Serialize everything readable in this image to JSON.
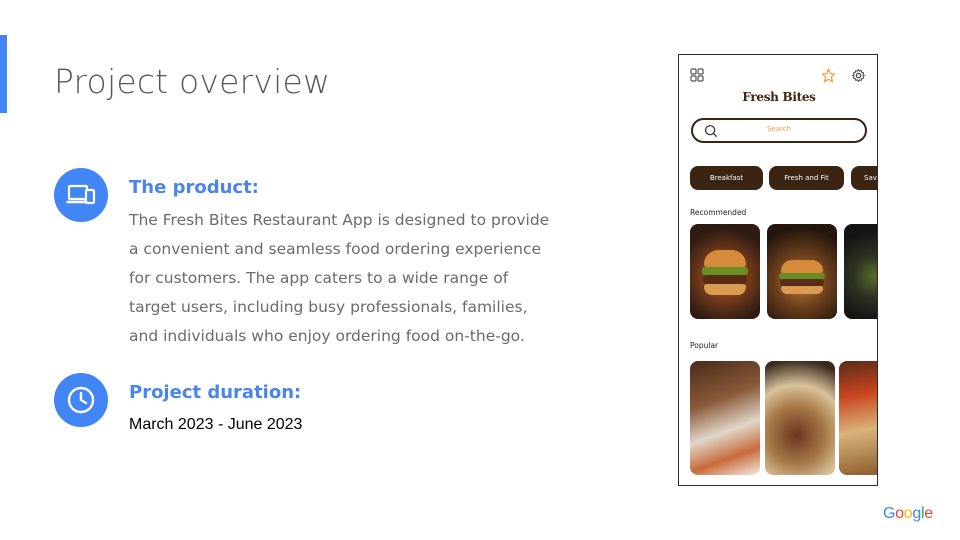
{
  "slide": {
    "title": "Project overview"
  },
  "product": {
    "heading": "The product:",
    "description": "The Fresh Bites Restaurant App is designed to provide a convenient and seamless food ordering experience for customers. The app caters to a wide range of target users, including busy professionals, families, and individuals who enjoy ordering food on-the-go.",
    "icon": "devices-icon"
  },
  "duration": {
    "heading": "Project duration:",
    "dates": "March 2023 - June 2023",
    "icon": "clock-icon"
  },
  "phone_mockup": {
    "brand": "Fresh Bites",
    "search_placeholder": "Search",
    "chips": [
      "Breakfast",
      "Fresh and Fit",
      "Sav"
    ],
    "recommended_label": "Recommended",
    "popular_label": "Popular",
    "icons": [
      "grid-icon",
      "star-icon",
      "gear-icon",
      "search-icon"
    ]
  },
  "footer": {
    "logo_letters": [
      "G",
      "o",
      "o",
      "g",
      "l",
      "e"
    ],
    "logo_colors": [
      "#4285f4",
      "#ea4335",
      "#fbbc05",
      "#4285f4",
      "#34a853",
      "#ea4335"
    ]
  },
  "colors": {
    "accent": "#4285f4",
    "heading": "#4a86e8",
    "brand_brown": "#3b2412",
    "search_text": "#f29c3d"
  }
}
